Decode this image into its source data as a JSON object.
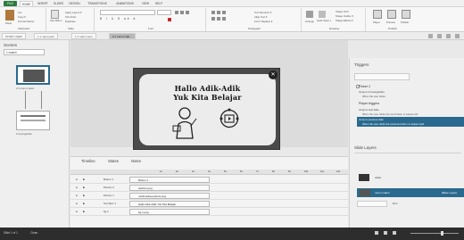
{
  "ribbon_tabs": [
    "FILE",
    "HOME",
    "INSERT",
    "SLIDES",
    "DESIGN",
    "TRANSITIONS",
    "ANIMATIONS",
    "VIEW",
    "HELP"
  ],
  "clipboard": {
    "paste": "Paste",
    "cut": "Cut",
    "copy": "Copy ▾",
    "format_painter": "Format Painter",
    "label": "Clipboard"
  },
  "slide_group": {
    "new_slide": "New Slide ▾",
    "layout": "Apply Layout ▾",
    "tab_order": "Tab Order",
    "duplicate": "Duplicate",
    "label": "Slide"
  },
  "font_group": {
    "label": "Font"
  },
  "paragraph_group": {
    "text_direction": "Text Direction ▾",
    "align_text": "Align Text ▾",
    "find_replace": "Find / Replace ▾",
    "label": "Paragraph"
  },
  "drawing_group": {
    "arrange": "Arrange",
    "quick_styles": "Quick Styles ▾",
    "shape_fill": "Shape Fill ▾",
    "shape_outline": "Shape Outline ▾",
    "shape_effects": "Shape Effects ▾",
    "label": "Drawing"
  },
  "publish_group": {
    "player": "Player",
    "preview": "Preview",
    "publish": "Publish",
    "label": "Publish"
  },
  "view_tabs": [
    "STORY VIEW",
    "1.1 menu quiz",
    "1.1 main menu",
    "2.1 menu mak..."
  ],
  "scenes": {
    "title": "Scenes",
    "selected": "1 materi",
    "thumb1_label": "2.1 menu materi",
    "thumb2_label": "2.2 pengertian"
  },
  "slide": {
    "title_line1": "Hallo Adik-Adik",
    "title_line2": "Yuk Kita Belajar"
  },
  "timeline": {
    "tabs": [
      "Timeline",
      "States",
      "Notes"
    ],
    "ruler": [
      "1s",
      "2s",
      "3s",
      "4s",
      "5s",
      "6s",
      "7s",
      "8s",
      "9s",
      "10s",
      "11s",
      "12s"
    ],
    "rows": [
      {
        "name": "Button 1",
        "bar": "Button 1"
      },
      {
        "name": "Picture 2",
        "bar": "teacher.png"
      },
      {
        "name": "Picture 1",
        "bar": "multimedia-options.png"
      },
      {
        "name": "Text Box 1",
        "bar": "Hallo Adik-Adik Yuk Kita Belajar"
      },
      {
        "name": "bg 1",
        "bar": "bg 1.png"
      }
    ]
  },
  "triggers": {
    "title": "Triggers",
    "object": "Picture 2",
    "jump1": "Jump to 2.2 pengertian",
    "when1": "When the user clicks",
    "player_triggers": "Player triggers",
    "jump2": "Jump to next slide",
    "when2": "When the user clicks the next button or swipes left",
    "jump3": "Jump to previous slide",
    "when3": "When the user clicks the previous button or swipes right"
  },
  "slide_layers": {
    "title": "Slide Layers",
    "video": "video",
    "base": "menu materi",
    "base_tag": "(Base Layer)",
    "dim": "Dim"
  },
  "status": {
    "slide": "Slide 1 of 1",
    "theme": "Clean"
  },
  "colors": {
    "file_tab": "#2d7b3d",
    "selection": "#2a6a8e"
  }
}
